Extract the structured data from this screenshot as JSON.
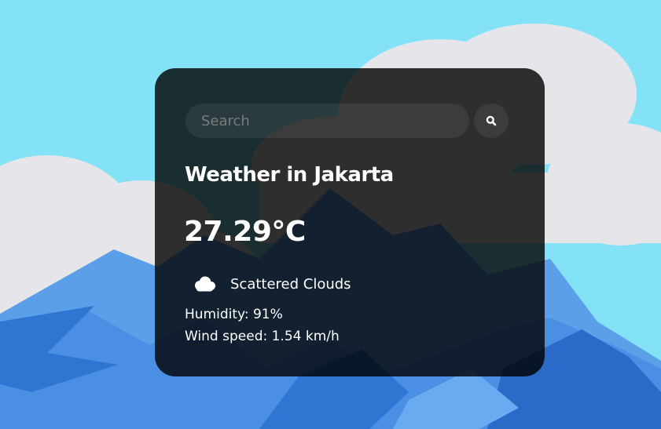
{
  "search": {
    "placeholder": "Search",
    "value": ""
  },
  "weather": {
    "title": "Weather in Jakarta",
    "temperature": "27.29°C",
    "condition": "Scattered Clouds",
    "condition_icon": "cloud-icon",
    "humidity": "Humidity: 91%",
    "wind": "Wind speed: 1.54 km/h"
  },
  "icons": {
    "search_button": "search-icon",
    "condition": "cloud-icon"
  },
  "colors": {
    "sky": "#84e2f6",
    "cloud": "#e6e6ea",
    "mountain_light": "#4e95e8",
    "mountain_dark": "#2e72cf",
    "card_bg": "rgba(0,0,0,0.80)",
    "text": "#ffffff",
    "placeholder": "#7b7b7b"
  }
}
